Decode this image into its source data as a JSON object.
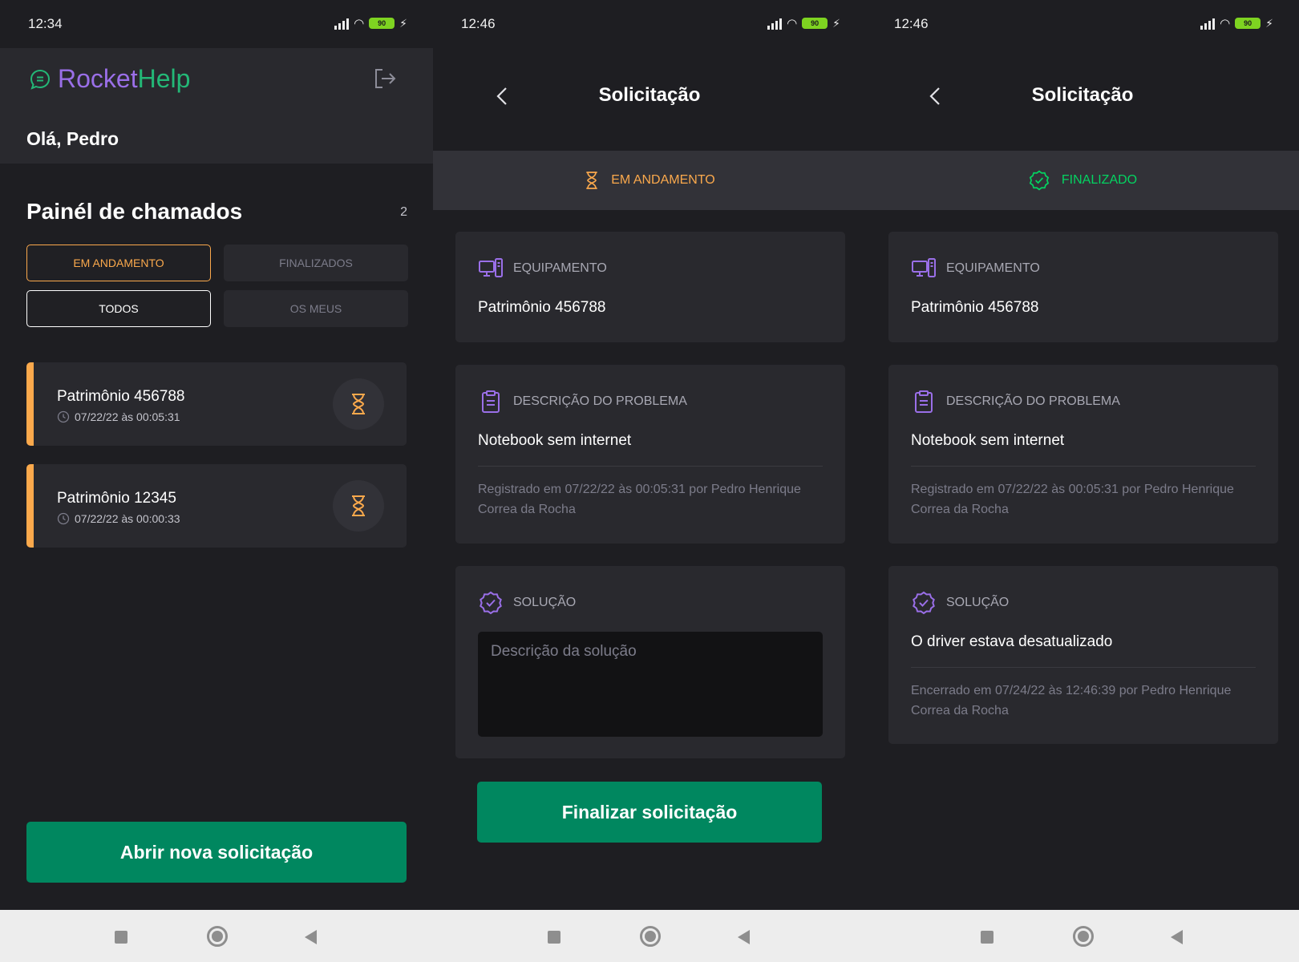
{
  "status_bars": [
    {
      "time": "12:34",
      "battery": "90"
    },
    {
      "time": "12:46",
      "battery": "90"
    },
    {
      "time": "12:46",
      "battery": "90"
    }
  ],
  "home": {
    "logo_part1": "Rocket",
    "logo_part2": "Help",
    "greeting": "Olá, Pedro",
    "panel_title": "Painél de chamados",
    "count": "2",
    "filters": {
      "in_progress": "EM ANDAMENTO",
      "finished": "FINALIZADOS",
      "all": "TODOS",
      "mine": "OS MEUS"
    },
    "orders": [
      {
        "title": "Patrimônio 456788",
        "date": "07/22/22 às 00:05:31"
      },
      {
        "title": "Patrimônio 12345",
        "date": "07/22/22 às 00:00:33"
      }
    ],
    "new_button": "Abrir nova solicitação"
  },
  "detail_open": {
    "title": "Solicitação",
    "status": "EM ANDAMENTO",
    "equipment_label": "EQUIPAMENTO",
    "equipment_value": "Patrimônio 456788",
    "description_label": "DESCRIÇÃO DO PROBLEMA",
    "description_value": "Notebook sem internet",
    "registered": "Registrado em 07/22/22 às 00:05:31 por Pedro Henrique Correa da Rocha",
    "solution_label": "SOLUÇÃO",
    "solution_placeholder": "Descrição da solução",
    "finish_button": "Finalizar solicitação"
  },
  "detail_closed": {
    "title": "Solicitação",
    "status": "FINALIZADO",
    "equipment_label": "EQUIPAMENTO",
    "equipment_value": "Patrimônio 456788",
    "description_label": "DESCRIÇÃO DO PROBLEMA",
    "description_value": "Notebook sem internet",
    "registered": "Registrado em 07/22/22 às 00:05:31 por Pedro Henrique Correa da Rocha",
    "solution_label": "SOLUÇÃO",
    "solution_value": "O driver estava desatualizado",
    "closed": "Encerrado em 07/24/22 às 12:46:39 por Pedro Henrique Correa da Rocha"
  },
  "colors": {
    "primary": "#00875f",
    "in_progress": "#fba94c",
    "finished": "#04d361",
    "accent_purple": "#9a6fe8"
  }
}
